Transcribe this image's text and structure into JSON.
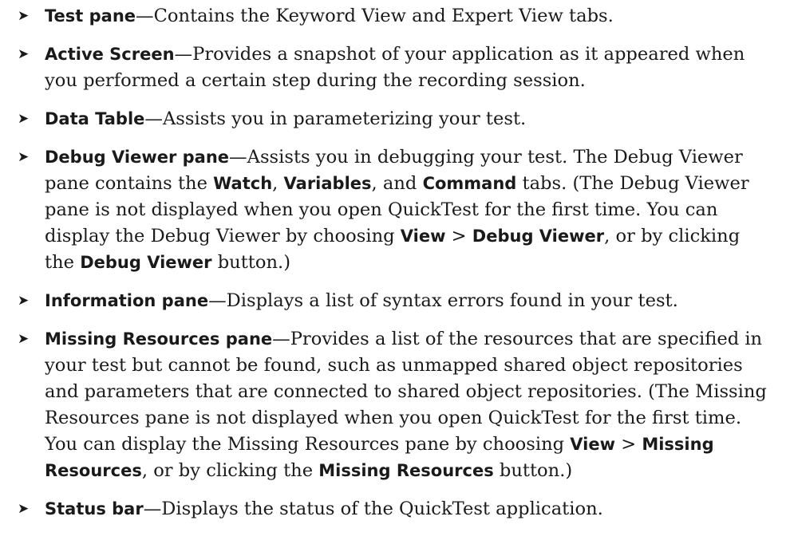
{
  "bullet_glyph": "➤",
  "items": [
    {
      "term": "Test pane",
      "text": "—Contains the Keyword View and Expert View tabs."
    },
    {
      "term": "Active Screen",
      "text": "—Provides a snapshot of your application as it appeared when you performed a certain step during the recording session."
    },
    {
      "term": "Data Table",
      "text": "—Assists you in parameterizing your test."
    },
    {
      "term": "Debug Viewer pane",
      "t1": "—Assists you in debugging your test. The Debug Viewer pane contains the ",
      "b1": "Watch",
      "t2": ", ",
      "b2": "Variables",
      "t3": ", and ",
      "b3": "Command",
      "t4": " tabs. (The Debug Viewer pane is not displayed when you open QuickTest for the first time. You can display the Debug Viewer by choosing ",
      "b4": "View",
      "t5": " > ",
      "b5": "Debug Viewer",
      "t6": ", or by clicking the ",
      "b6": "Debug Viewer",
      "t7": " button.)"
    },
    {
      "term": "Information pane",
      "text": "—Displays a list of syntax errors found in your test."
    },
    {
      "term": "Missing Resources pane",
      "t1": "—Provides a list of the resources that are specified in your test but cannot be found, such as unmapped shared object repositories and parameters that are connected to shared object repositories. (The Missing Resources pane is not displayed when you open QuickTest for the first time. You can display the Missing Resources pane by choosing ",
      "b1": "View",
      "t2": " > ",
      "b2": "Missing Resources",
      "t3": ", or by clicking the ",
      "b3": "Missing Resources",
      "t4": " button.)"
    },
    {
      "term": "Status bar",
      "text": "—Displays the status of the QuickTest application."
    }
  ]
}
